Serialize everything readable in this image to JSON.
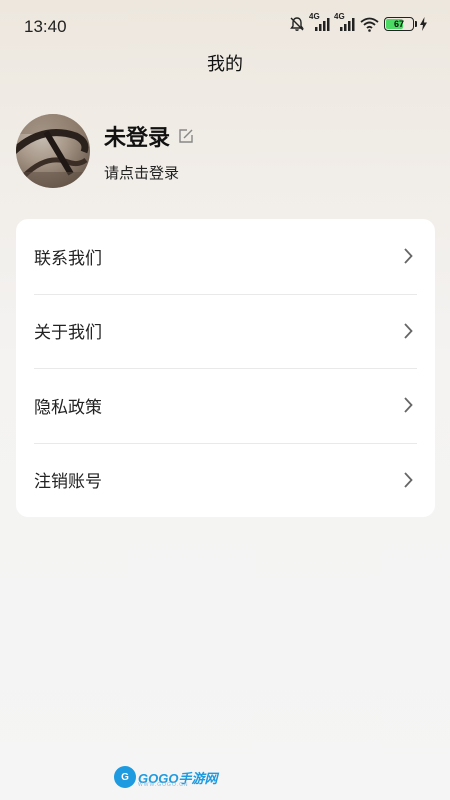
{
  "status_bar": {
    "time": "13:40",
    "network_1": "4G",
    "network_2": "4G",
    "battery_percent": "67",
    "battery_level": 0.67,
    "battery_color": "#4cd964",
    "icons": [
      "mute-bell-icon",
      "signal-icon",
      "signal-icon",
      "wifi-icon",
      "battery-icon",
      "charging-icon"
    ]
  },
  "header": {
    "title": "我的"
  },
  "profile": {
    "name": "未登录",
    "subtitle": "请点击登录",
    "edit_icon": "edit-icon"
  },
  "menu": {
    "items": [
      {
        "label": "联系我们",
        "icon": "chevron-right-icon"
      },
      {
        "label": "关于我们",
        "icon": "chevron-right-icon"
      },
      {
        "label": "隐私政策",
        "icon": "chevron-right-icon"
      },
      {
        "label": "注销账号",
        "icon": "chevron-right-icon"
      }
    ]
  },
  "watermark": {
    "logo_letter": "G",
    "text": "GOGO手游网",
    "sub": "WWW.GOGO.CN",
    "color": "#1e9be0"
  }
}
